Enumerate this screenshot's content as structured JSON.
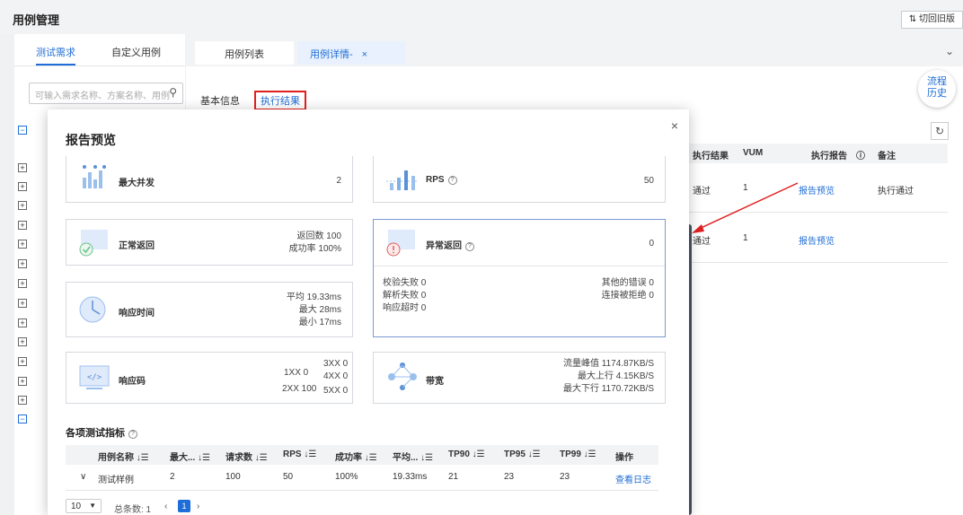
{
  "header": {
    "title": "用例管理",
    "switch_label": "⇅ 切回旧版"
  },
  "tree": {
    "tabs": [
      "测试需求",
      "自定义用例"
    ],
    "search_placeholder": "可输入需求名称、方案名称、用例"
  },
  "doc_tabs": {
    "list_label": "用例列表",
    "detail_label": "用例详情-",
    "close": "×"
  },
  "sub_tabs": {
    "basic": "基本信息",
    "result": "执行结果"
  },
  "history_float": {
    "line1": "流程",
    "line2": "历史"
  },
  "bg_table": {
    "headers": [
      "执行结果",
      "VUM",
      "执行报告",
      "备注"
    ],
    "rows": [
      {
        "result": "通过",
        "vum": "1",
        "report": "报告预览",
        "remark": "执行通过"
      },
      {
        "result": "通过",
        "vum": "1",
        "report": "报告预览",
        "remark": ""
      }
    ]
  },
  "modal": {
    "title": "报告预览",
    "close": "×",
    "cards": {
      "max_concurrency": {
        "label": "最大并发",
        "value": "2"
      },
      "rps": {
        "label": "RPS",
        "value": "50"
      },
      "normal_return": {
        "label": "正常返回",
        "line1": "返回数 100",
        "line2": "成功率 100%"
      },
      "abnormal_return": {
        "label": "异常返回",
        "value": "0",
        "left": [
          "校验失败 0",
          "解析失败 0",
          "响应超时 0"
        ],
        "right": [
          "其他的错误 0",
          "连接被拒绝 0"
        ]
      },
      "response_time": {
        "label": "响应时间",
        "avg": "平均 19.33ms",
        "max": "最大 28ms",
        "min": "最小 17ms"
      },
      "response_code": {
        "label": "响应码",
        "c1xx": "1XX 0",
        "c2xx": "2XX 100",
        "c3xx": "3XX 0",
        "c4xx": "4XX 0",
        "c5xx": "5XX 0"
      },
      "bandwidth": {
        "label": "带宽",
        "peak": "流量峰值 1174.87KB/S",
        "up": "最大上行 4.15KB/S",
        "down": "最大下行 1170.72KB/S"
      }
    },
    "metrics": {
      "title": "各项测试指标",
      "headers": [
        "用例名称 ↓☰",
        "最大... ↓☰",
        "请求数 ↓☰",
        "RPS ↓☰",
        "成功率 ↓☰",
        "平均... ↓☰",
        "TP90 ↓☰",
        "TP95 ↓☰",
        "TP99 ↓☰",
        "操作"
      ],
      "row": {
        "name": "测试样例",
        "max": "2",
        "requests": "100",
        "rps": "50",
        "success": "100%",
        "avg": "19.33ms",
        "tp90": "21",
        "tp95": "23",
        "tp99": "23",
        "action": "查看日志"
      },
      "expand": "∨"
    },
    "pager": {
      "size": "10",
      "total": "总条数: 1",
      "prev": "‹",
      "page": "1",
      "next": "›"
    }
  },
  "colors": {
    "accent": "#1f6dd6",
    "annotation": "#e02020"
  }
}
